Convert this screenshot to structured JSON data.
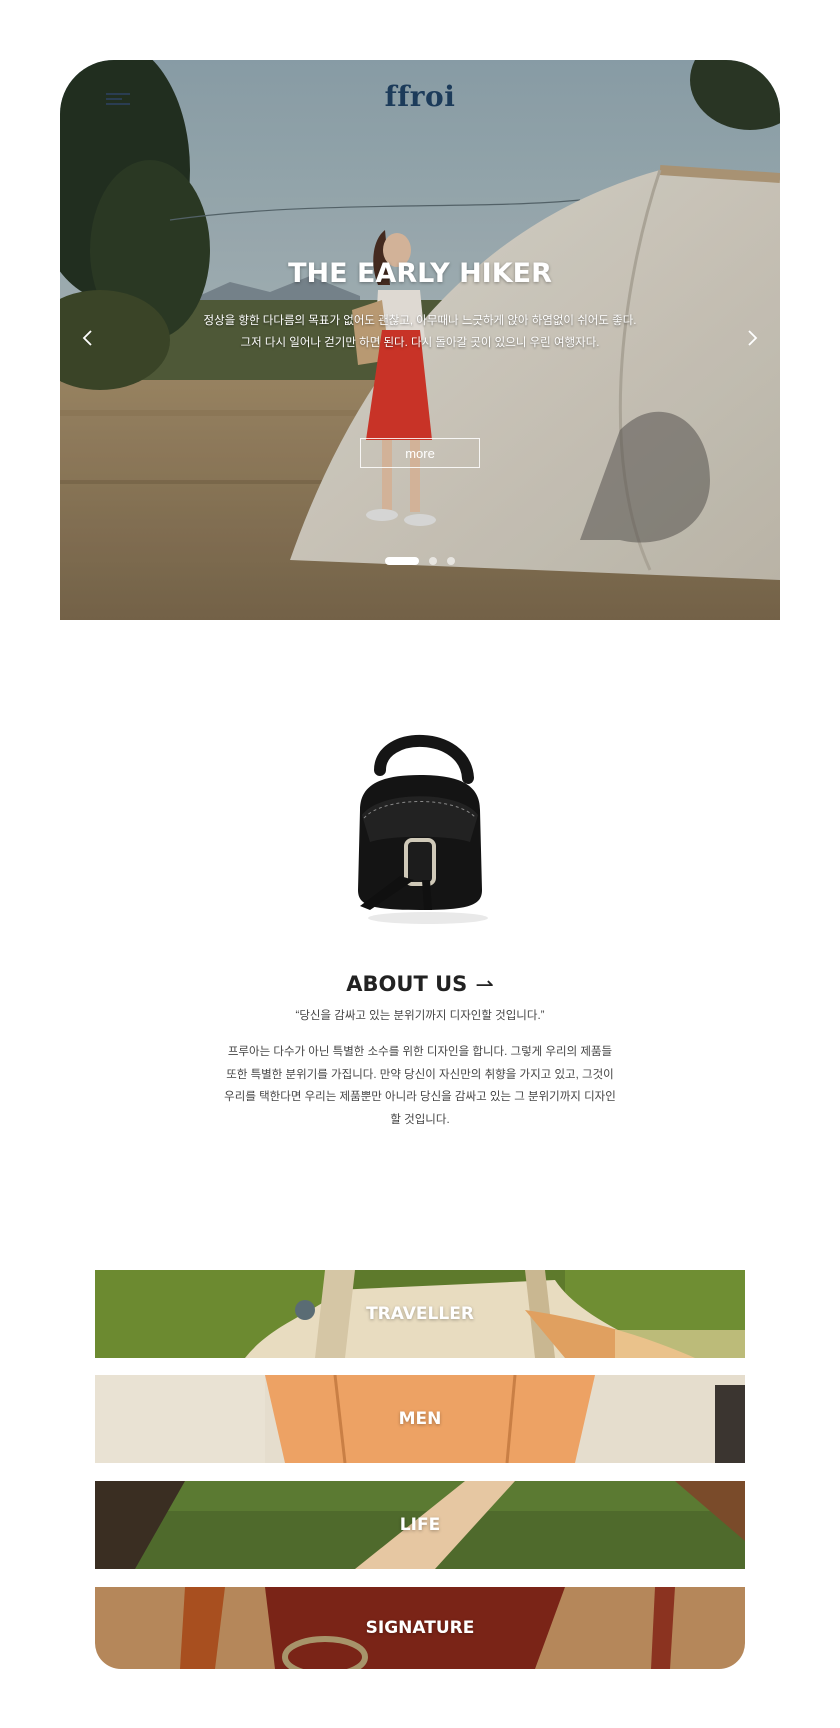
{
  "header": {
    "logo": "ffroi",
    "menu_icon": "hamburger-menu-icon"
  },
  "hero": {
    "title": "THE EARLY HIKER",
    "description_lines": [
      "정상을 향한 다다름의 목표가 없어도 괜찮고, 아무때나 느긋하게 앉아 하염없이 쉬어도 좋다.",
      "그저 다시 일어나 걷기만 하면 된다. 다시 돌아갈 곳이 있으니 우린 여행자다."
    ],
    "more_label": "more",
    "prev_icon": "chevron-left-icon",
    "next_icon": "chevron-right-icon",
    "slides_total": 3,
    "active_slide": 1
  },
  "about": {
    "title": "ABOUT US",
    "arrow": "⇀",
    "quote": "“당신을 감싸고 있는 분위기까지 디자인할 것입니다.”",
    "body_lines": [
      "프루아는 다수가 아닌 특별한 소수를 위한 디자인을 합니다. 그렇게 우리의 제품들",
      "또한 특별한 분위기를 가집니다. 만약 당신이 자신만의 취향을 가지고 있고, 그것이",
      "우리를 택한다면 우리는 제품뿐만 아니라 당신을 감싸고 있는 그 분위기까지 디자인",
      "할 것입니다."
    ]
  },
  "categories": [
    {
      "label": "TRAVELLER"
    },
    {
      "label": "MEN"
    },
    {
      "label": "LIFE"
    },
    {
      "label": "SIGNATURE"
    }
  ],
  "colors": {
    "logo": "#1c3b5a",
    "sky": "#9eb1b9",
    "dress": "#d9382b",
    "text": "#222222"
  }
}
